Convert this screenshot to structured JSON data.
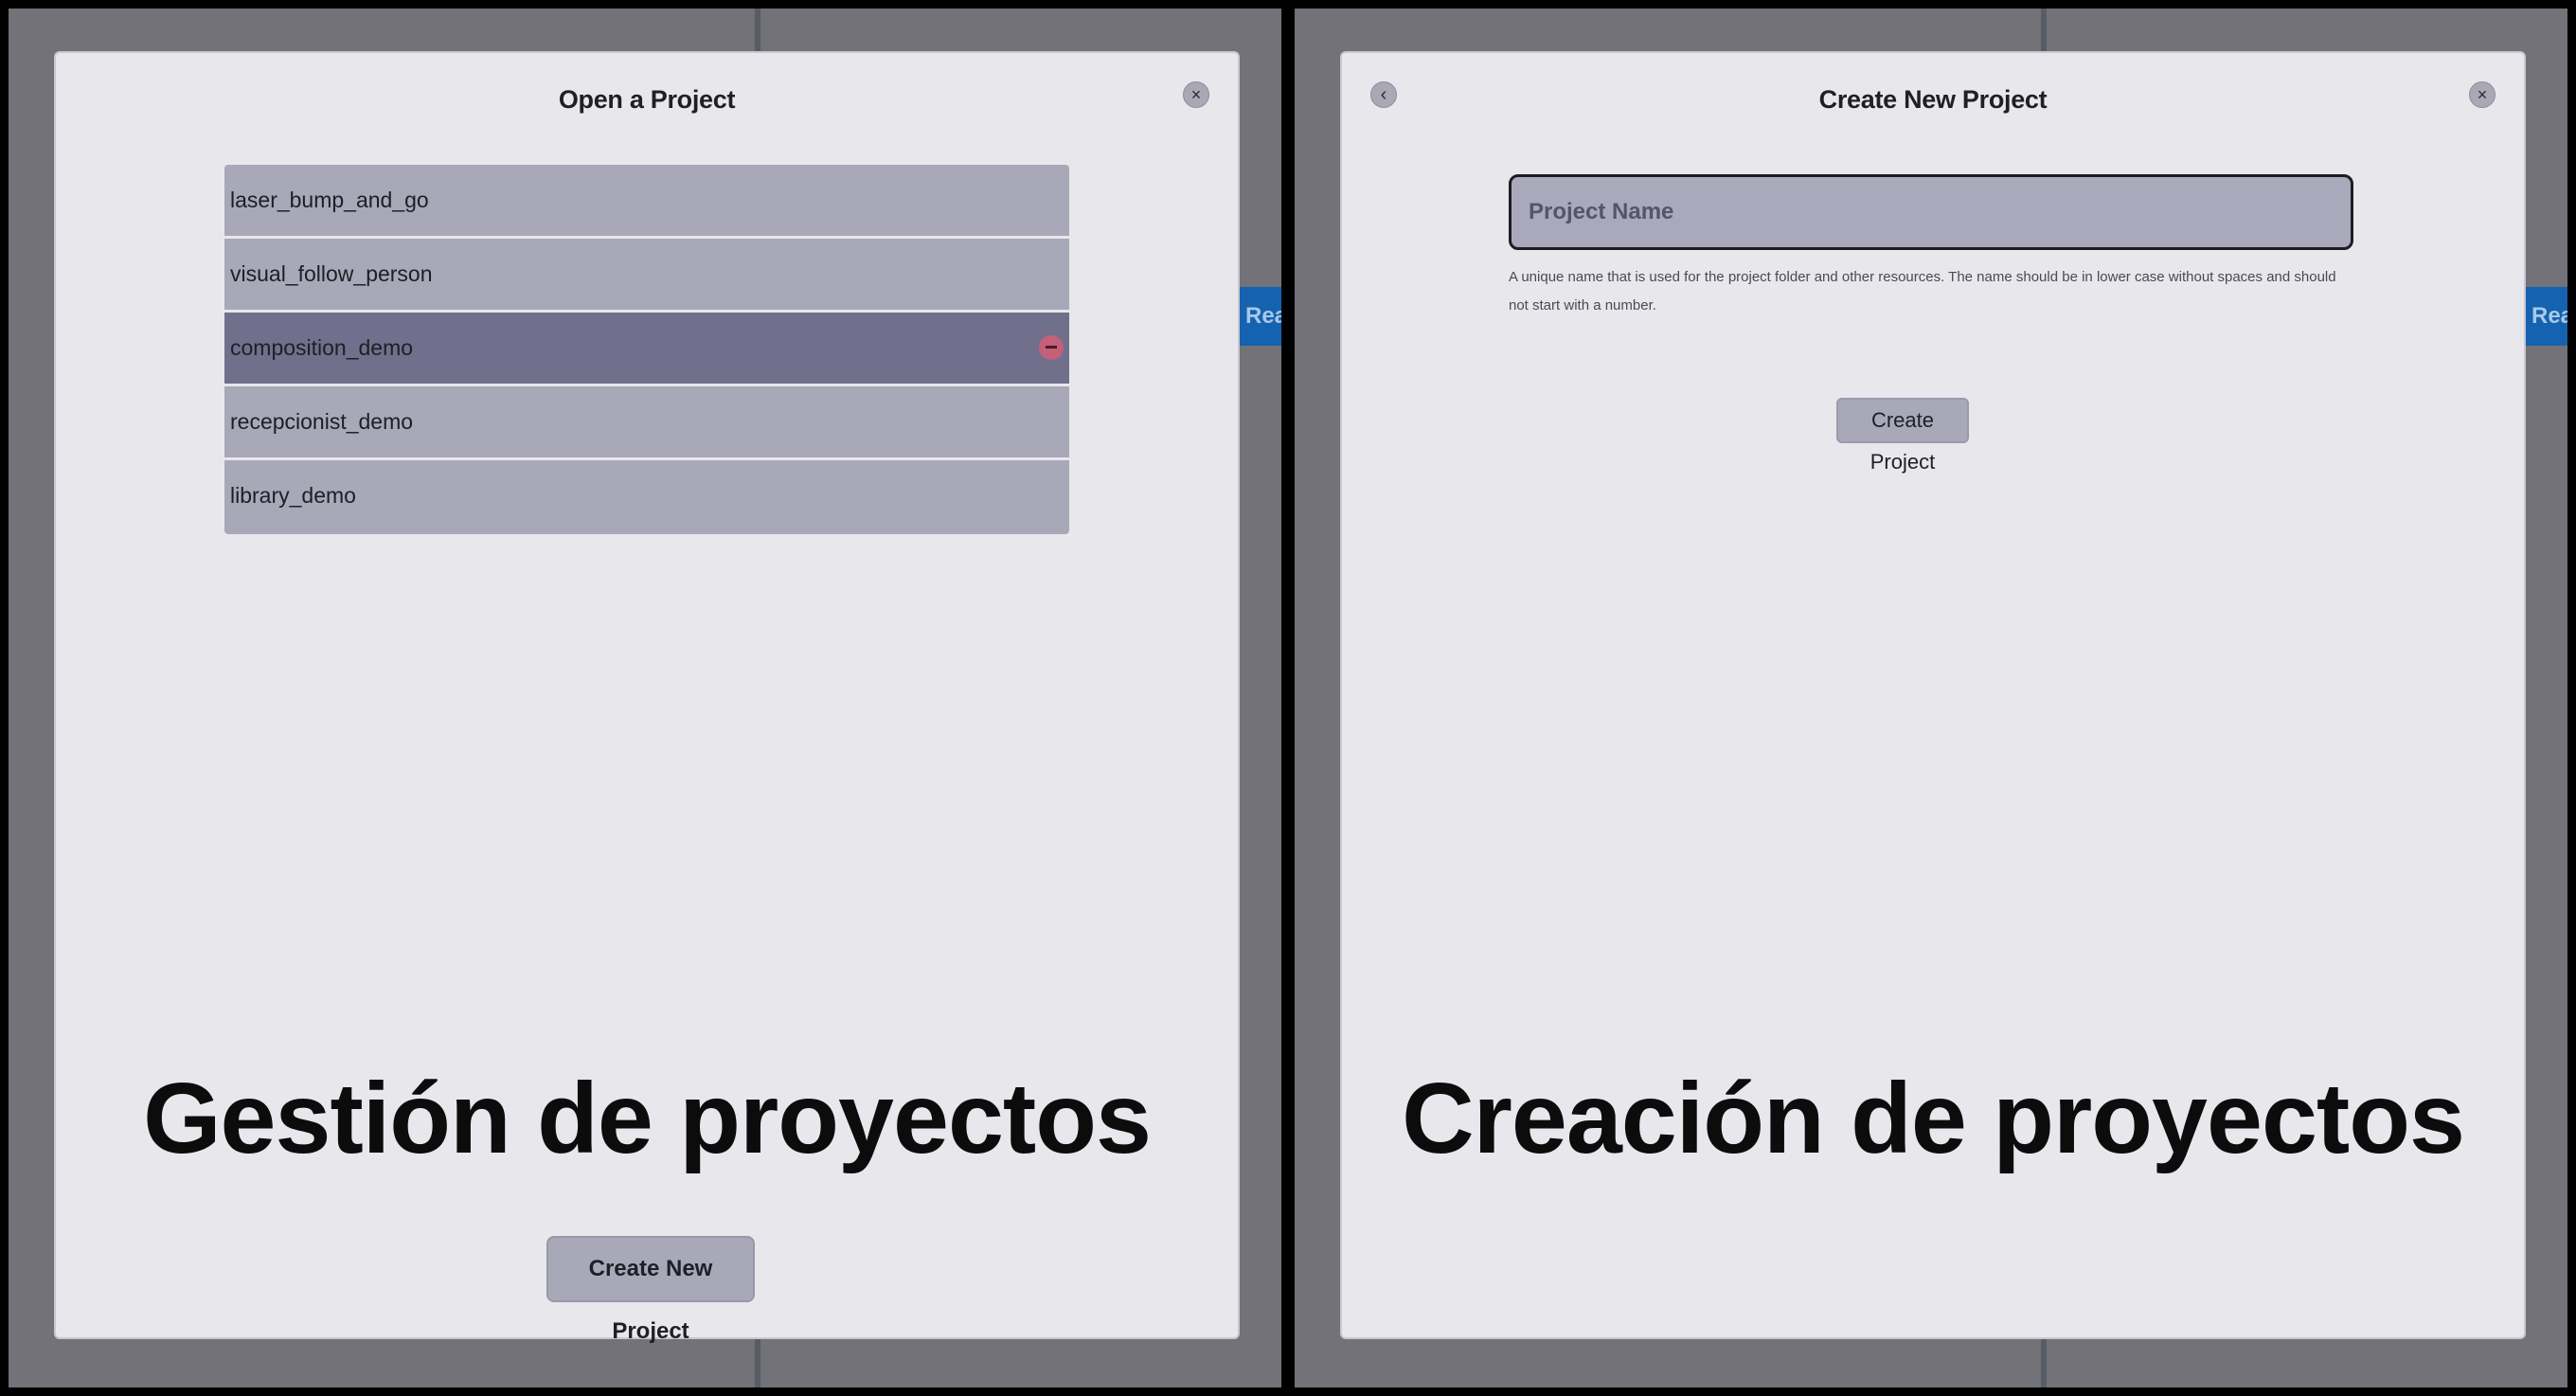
{
  "left_panel": {
    "side_tab": "Reac",
    "dialog": {
      "title": "Open a Project",
      "close_icon": "×",
      "projects": [
        {
          "name": "laser_bump_and_go"
        },
        {
          "name": "visual_follow_person"
        },
        {
          "name": "composition_demo",
          "selected": true
        },
        {
          "name": "recepcionist_demo"
        },
        {
          "name": "library_demo"
        }
      ],
      "caption": "Gestión de proyectos",
      "create_new_button": "Create New Project"
    }
  },
  "right_panel": {
    "side_tab": "Reac",
    "dialog": {
      "title": "Create New Project",
      "back_icon": "‹",
      "close_icon": "×",
      "name_placeholder": "Project Name",
      "helper_text": "A unique name that is used for the project folder and other resources. The name should be in lower case without spaces and should not start with a number.",
      "caption": "Creación de proyectos",
      "create_button": "Create Project"
    }
  },
  "colors": {
    "dialog_bg": "#e8e7ec",
    "row_bg": "#a8a8b8",
    "row_selected_bg": "#70708c",
    "remove_icon": "#c4607a",
    "side_tab_bg": "#1462b0"
  }
}
